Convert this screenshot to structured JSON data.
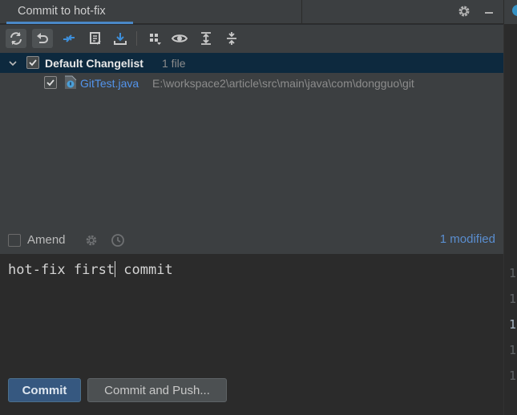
{
  "tab": {
    "title": "Commit to hot-fix"
  },
  "tabbar_icons": [
    "gear-icon",
    "minimize-icon"
  ],
  "toolbar": {
    "buttons": [
      "refresh-icon",
      "rollback-icon",
      "diff-icon",
      "edit-icon",
      "shelve-icon",
      "group-by-icon",
      "preview-icon",
      "expand-all-icon",
      "collapse-all-icon"
    ]
  },
  "tree": {
    "group": {
      "name": "Default Changelist",
      "count": "1 file",
      "checked": true,
      "expanded": true
    },
    "files": [
      {
        "name": "GitTest.java",
        "path": "E:\\workspace2\\article\\src\\main\\java\\com\\dongguo\\git",
        "checked": true
      }
    ]
  },
  "options": {
    "amend_label": "Amend",
    "amend_checked": false,
    "modified_text": "1 modified"
  },
  "message": {
    "before_caret": "hot-fix first",
    "after_caret": " commit"
  },
  "buttons": {
    "commit": "Commit",
    "commit_push": "Commit and Push..."
  },
  "gutter": {
    "lines": [
      "1",
      "1",
      "1",
      "1",
      "1"
    ]
  },
  "colors": {
    "accent": "#4a88c7",
    "selection": "#0d293e",
    "file_link": "#5394ec",
    "modified": "#5a8ed0",
    "primary_button": "#365880"
  }
}
